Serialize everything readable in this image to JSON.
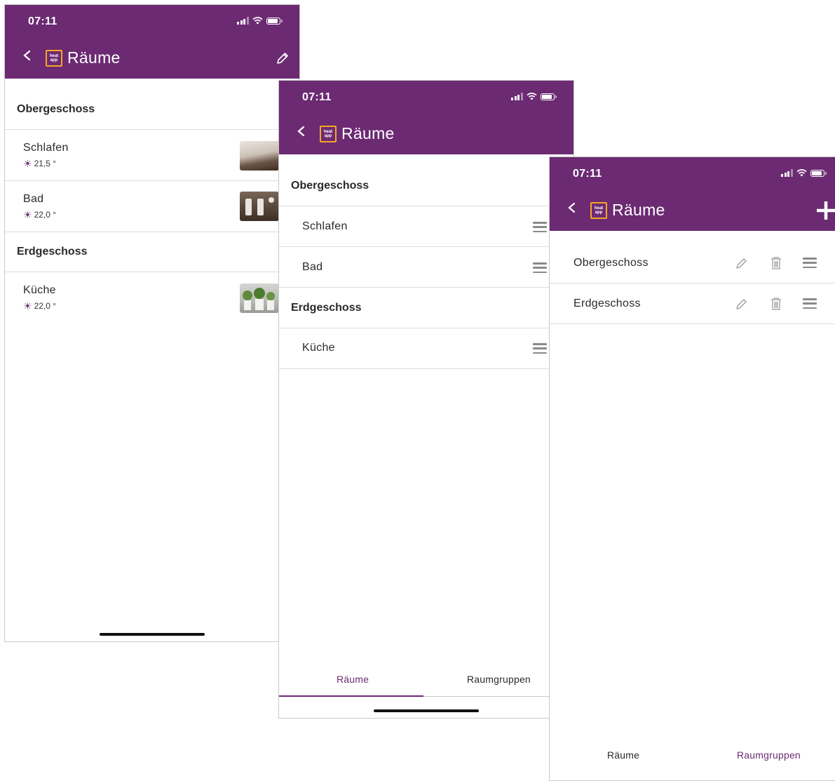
{
  "status": {
    "time": "07:11"
  },
  "header": {
    "title": "Räume",
    "logo_text": "heat app"
  },
  "screen1": {
    "sections": [
      {
        "name": "Obergeschoss",
        "rooms": [
          {
            "name": "Schlafen",
            "temp": "21,5 °"
          },
          {
            "name": "Bad",
            "temp": "22,0 °"
          }
        ]
      },
      {
        "name": "Erdgeschoss",
        "rooms": [
          {
            "name": "Küche",
            "temp": "22,0 °"
          }
        ]
      }
    ]
  },
  "screen2": {
    "sections": [
      {
        "name": "Obergeschoss",
        "rooms": [
          "Schlafen",
          "Bad"
        ]
      },
      {
        "name": "Erdgeschoss",
        "rooms": [
          "Küche"
        ]
      }
    ],
    "tabs": [
      "Räume",
      "Raumgruppen"
    ],
    "active_tab": "Räume"
  },
  "screen3": {
    "groups": [
      "Obergeschoss",
      "Erdgeschoss"
    ],
    "tabs": [
      "Räume",
      "Raumgruppen"
    ],
    "active_tab": "Raumgruppen"
  },
  "colors": {
    "primary": "#6c2a73",
    "logo_accent": "#f5a623"
  }
}
